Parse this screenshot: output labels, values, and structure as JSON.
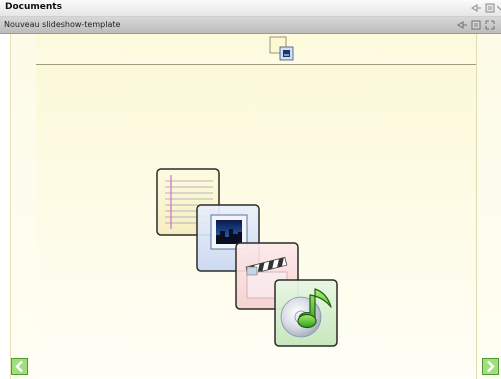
{
  "window": {
    "title": "Documents"
  },
  "panel": {
    "title": "Nouveau slideshow-template"
  },
  "icons": {
    "thumbnail": "slide-thumbnail-icon",
    "prev": "arrow-left-icon",
    "next": "arrow-right-icon",
    "media": "multimedia-documents-icon"
  },
  "colors": {
    "slide_background": "#fcf9da",
    "nav_button": "#8fd66a"
  }
}
